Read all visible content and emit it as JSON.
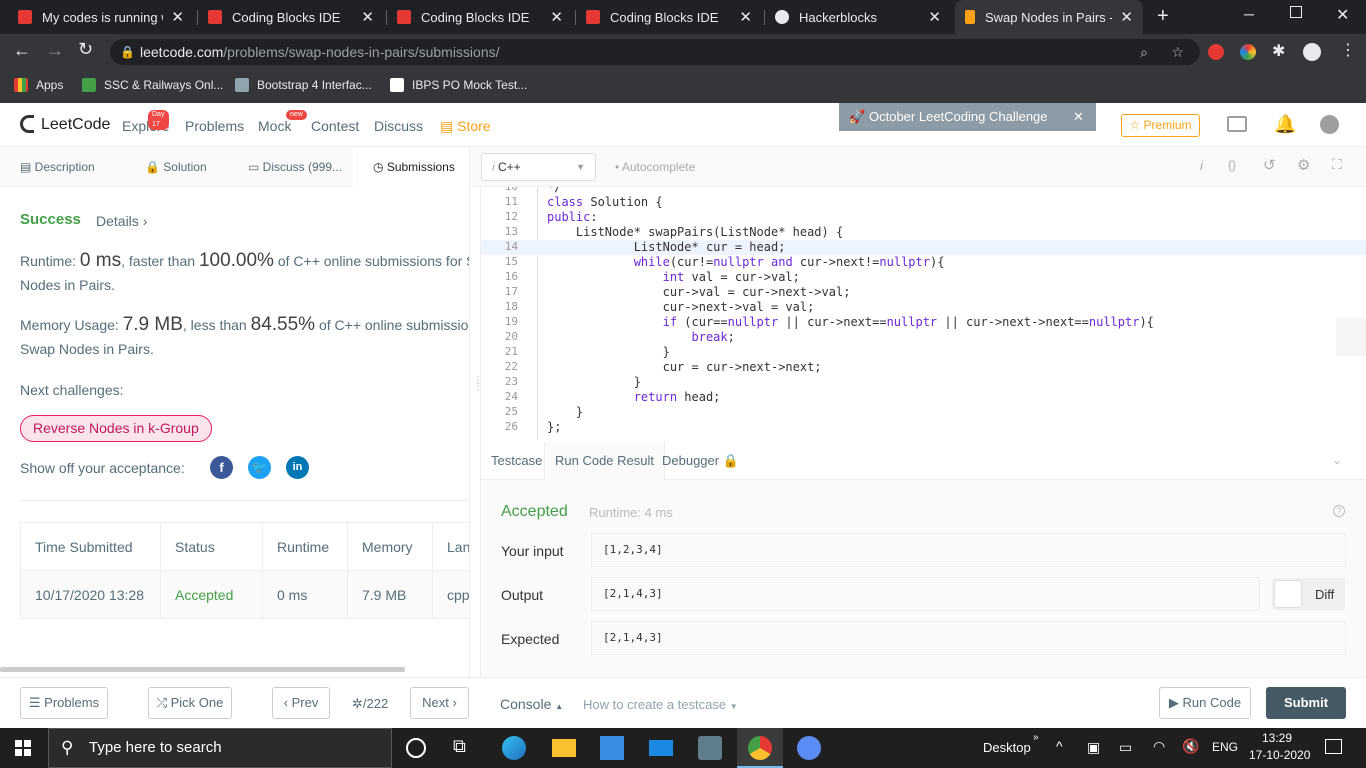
{
  "browser": {
    "tabs": [
      {
        "title": "My codes is running we",
        "active": false
      },
      {
        "title": "Coding Blocks IDE",
        "active": false
      },
      {
        "title": "Coding Blocks IDE",
        "active": false
      },
      {
        "title": "Coding Blocks IDE",
        "active": false
      },
      {
        "title": "Hackerblocks",
        "active": false
      },
      {
        "title": "Swap Nodes in Pairs - L",
        "active": true
      }
    ],
    "url_host": "leetcode.com",
    "url_path": "/problems/swap-nodes-in-pairs/submissions/",
    "bookmarks": [
      "Apps",
      "SSC & Railways Onl...",
      "Bootstrap 4 Interfac...",
      "IBPS PO Mock Test..."
    ]
  },
  "leetcode_nav": {
    "logo": "LeetCode",
    "items": [
      "Explore",
      "Problems",
      "Mock",
      "Contest",
      "Discuss"
    ],
    "explore_badge": "Day 17",
    "mock_badge": "new",
    "store": "Store",
    "challenge": "October LeetCoding Challenge",
    "premium": "Premium"
  },
  "left_tabs": [
    "Description",
    "Solution",
    "Discuss (999...",
    "Submissions"
  ],
  "result": {
    "status": "Success",
    "details": "Details",
    "runtime_label": "Runtime:",
    "runtime_value": "0 ms",
    "runtime_faster": ", faster than",
    "runtime_pct": "100.00%",
    "runtime_rest": "of C++ online submissions for S",
    "runtime_rest2": "Nodes in Pairs.",
    "memory_label": "Memory Usage:",
    "memory_value": "7.9 MB",
    "memory_less": ", less than",
    "memory_pct": "84.55%",
    "memory_rest": "of C++ online submission",
    "memory_rest2": "Swap Nodes in Pairs.",
    "next_challenges": "Next challenges:",
    "challenge_link": "Reverse Nodes in k-Group",
    "show_off": "Show off your acceptance:"
  },
  "submissions_table": {
    "headers": [
      "Time Submitted",
      "Status",
      "Runtime",
      "Memory",
      "Lang"
    ],
    "rows": [
      [
        "10/17/2020 13:28",
        "Accepted",
        "0 ms",
        "7.9 MB",
        "cpp"
      ]
    ]
  },
  "editor": {
    "language": "C++",
    "autocomplete": "Autocomplete",
    "lines": [
      {
        "n": "10",
        "code": "*/"
      },
      {
        "n": "11",
        "code": "class Solution {"
      },
      {
        "n": "12",
        "code": "public:"
      },
      {
        "n": "13",
        "code": "    ListNode* swapPairs(ListNode* head) {"
      },
      {
        "n": "14",
        "code": "            ListNode* cur = head;"
      },
      {
        "n": "15",
        "code": "            while(cur!=nullptr and cur->next!=nullptr){"
      },
      {
        "n": "16",
        "code": "                int val = cur->val;"
      },
      {
        "n": "17",
        "code": "                cur->val = cur->next->val;"
      },
      {
        "n": "18",
        "code": "                cur->next->val = val;"
      },
      {
        "n": "19",
        "code": "                if (cur==nullptr || cur->next==nullptr || cur->next->next==nullptr){"
      },
      {
        "n": "20",
        "code": "                    break;"
      },
      {
        "n": "21",
        "code": "                }"
      },
      {
        "n": "22",
        "code": "                cur = cur->next->next;"
      },
      {
        "n": "23",
        "code": "            }"
      },
      {
        "n": "24",
        "code": "            return head;"
      },
      {
        "n": "25",
        "code": "    }"
      },
      {
        "n": "26",
        "code": "};"
      }
    ]
  },
  "console": {
    "tabs": [
      "Testcase",
      "Run Code Result",
      "Debugger"
    ],
    "status": "Accepted",
    "runtime": "Runtime: 4 ms",
    "input_label": "Your input",
    "input_value": "[1,2,3,4]",
    "output_label": "Output",
    "output_value": "[2,1,4,3]",
    "diff": "Diff",
    "expected_label": "Expected",
    "expected_value": "[2,1,4,3]"
  },
  "bottom": {
    "problems": "Problems",
    "pick_one": "Pick One",
    "prev": "Prev",
    "page": "/222",
    "next": "Next",
    "console": "Console",
    "how_to": "How to create a testcase",
    "run_code": "Run Code",
    "submit": "Submit"
  },
  "taskbar": {
    "search_placeholder": "Type here to search",
    "desktop": "Desktop",
    "lang": "ENG",
    "time": "13:29",
    "date": "17-10-2020"
  },
  "colors": {
    "accent_green": "#43a047",
    "premium_orange": "#ffa116",
    "submit_bg": "#455a64"
  }
}
